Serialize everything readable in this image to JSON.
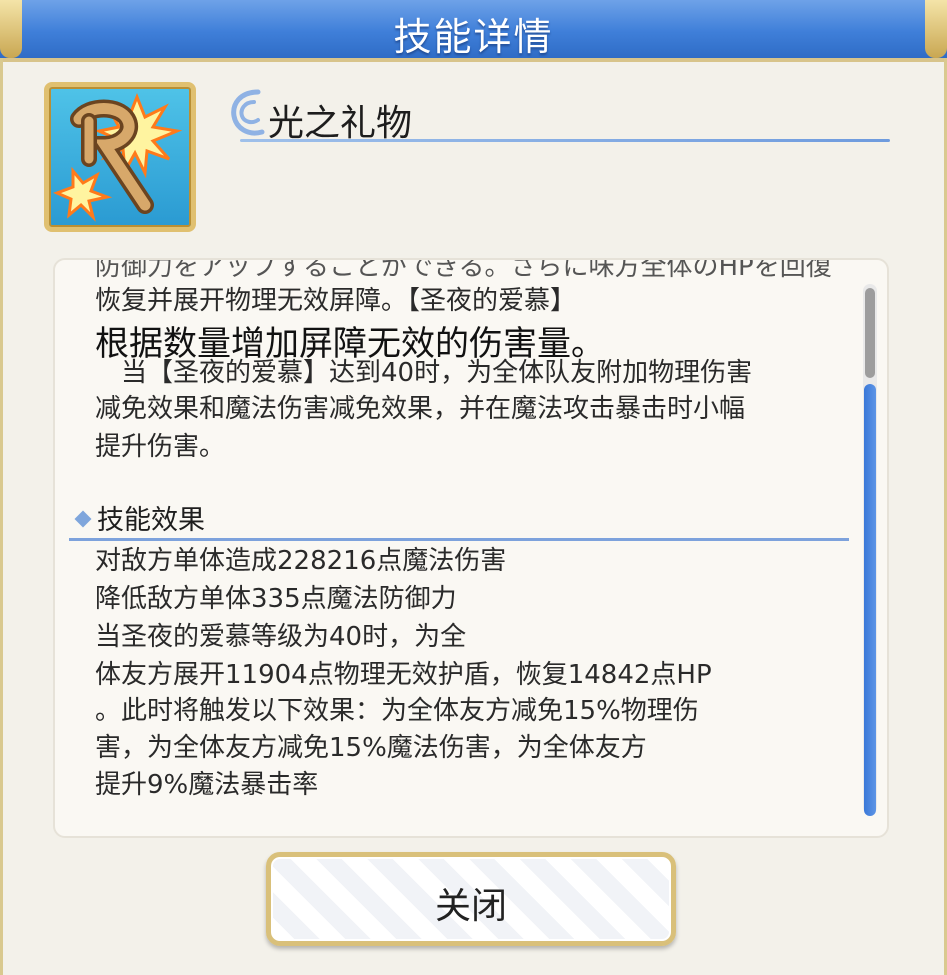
{
  "window": {
    "title": "技能详情"
  },
  "skill": {
    "icon": "skill-rune-icon",
    "name": "光之礼物"
  },
  "description": {
    "cut_line": "防御力をアップすることができる。さらに味方全体のHPを回復",
    "lines": [
      "恢复并展开物理无效屏障。【圣夜的爱慕】",
      "根据数量增加屏障无效的伤害量。",
      "　当【圣夜的爱慕】达到40时，为全体队友附加物理伤害",
      "减免效果和魔法伤害减免效果，并在魔法攻击暴击时小幅",
      "提升伤害。"
    ]
  },
  "effects": {
    "heading": "技能效果",
    "lines": [
      "对敌方单体造成228216点魔法伤害",
      "降低敌方单体335点魔法防御力",
      "当圣夜的爱慕等级为40时，为全",
      "体友方展开11904点物理无效护盾，恢复14842点HP",
      "。此时将触发以下效果：为全体友方减免15%物理伤",
      "害，为全体友方减免15%魔法伤害，为全体友方",
      "提升9%魔法暴击率"
    ]
  },
  "buttons": {
    "close_label": "关闭"
  },
  "colors": {
    "title_bar": "#3f7fd9",
    "accent_gold": "#d9c07a",
    "scroll_thumb": "#3a78d8"
  }
}
